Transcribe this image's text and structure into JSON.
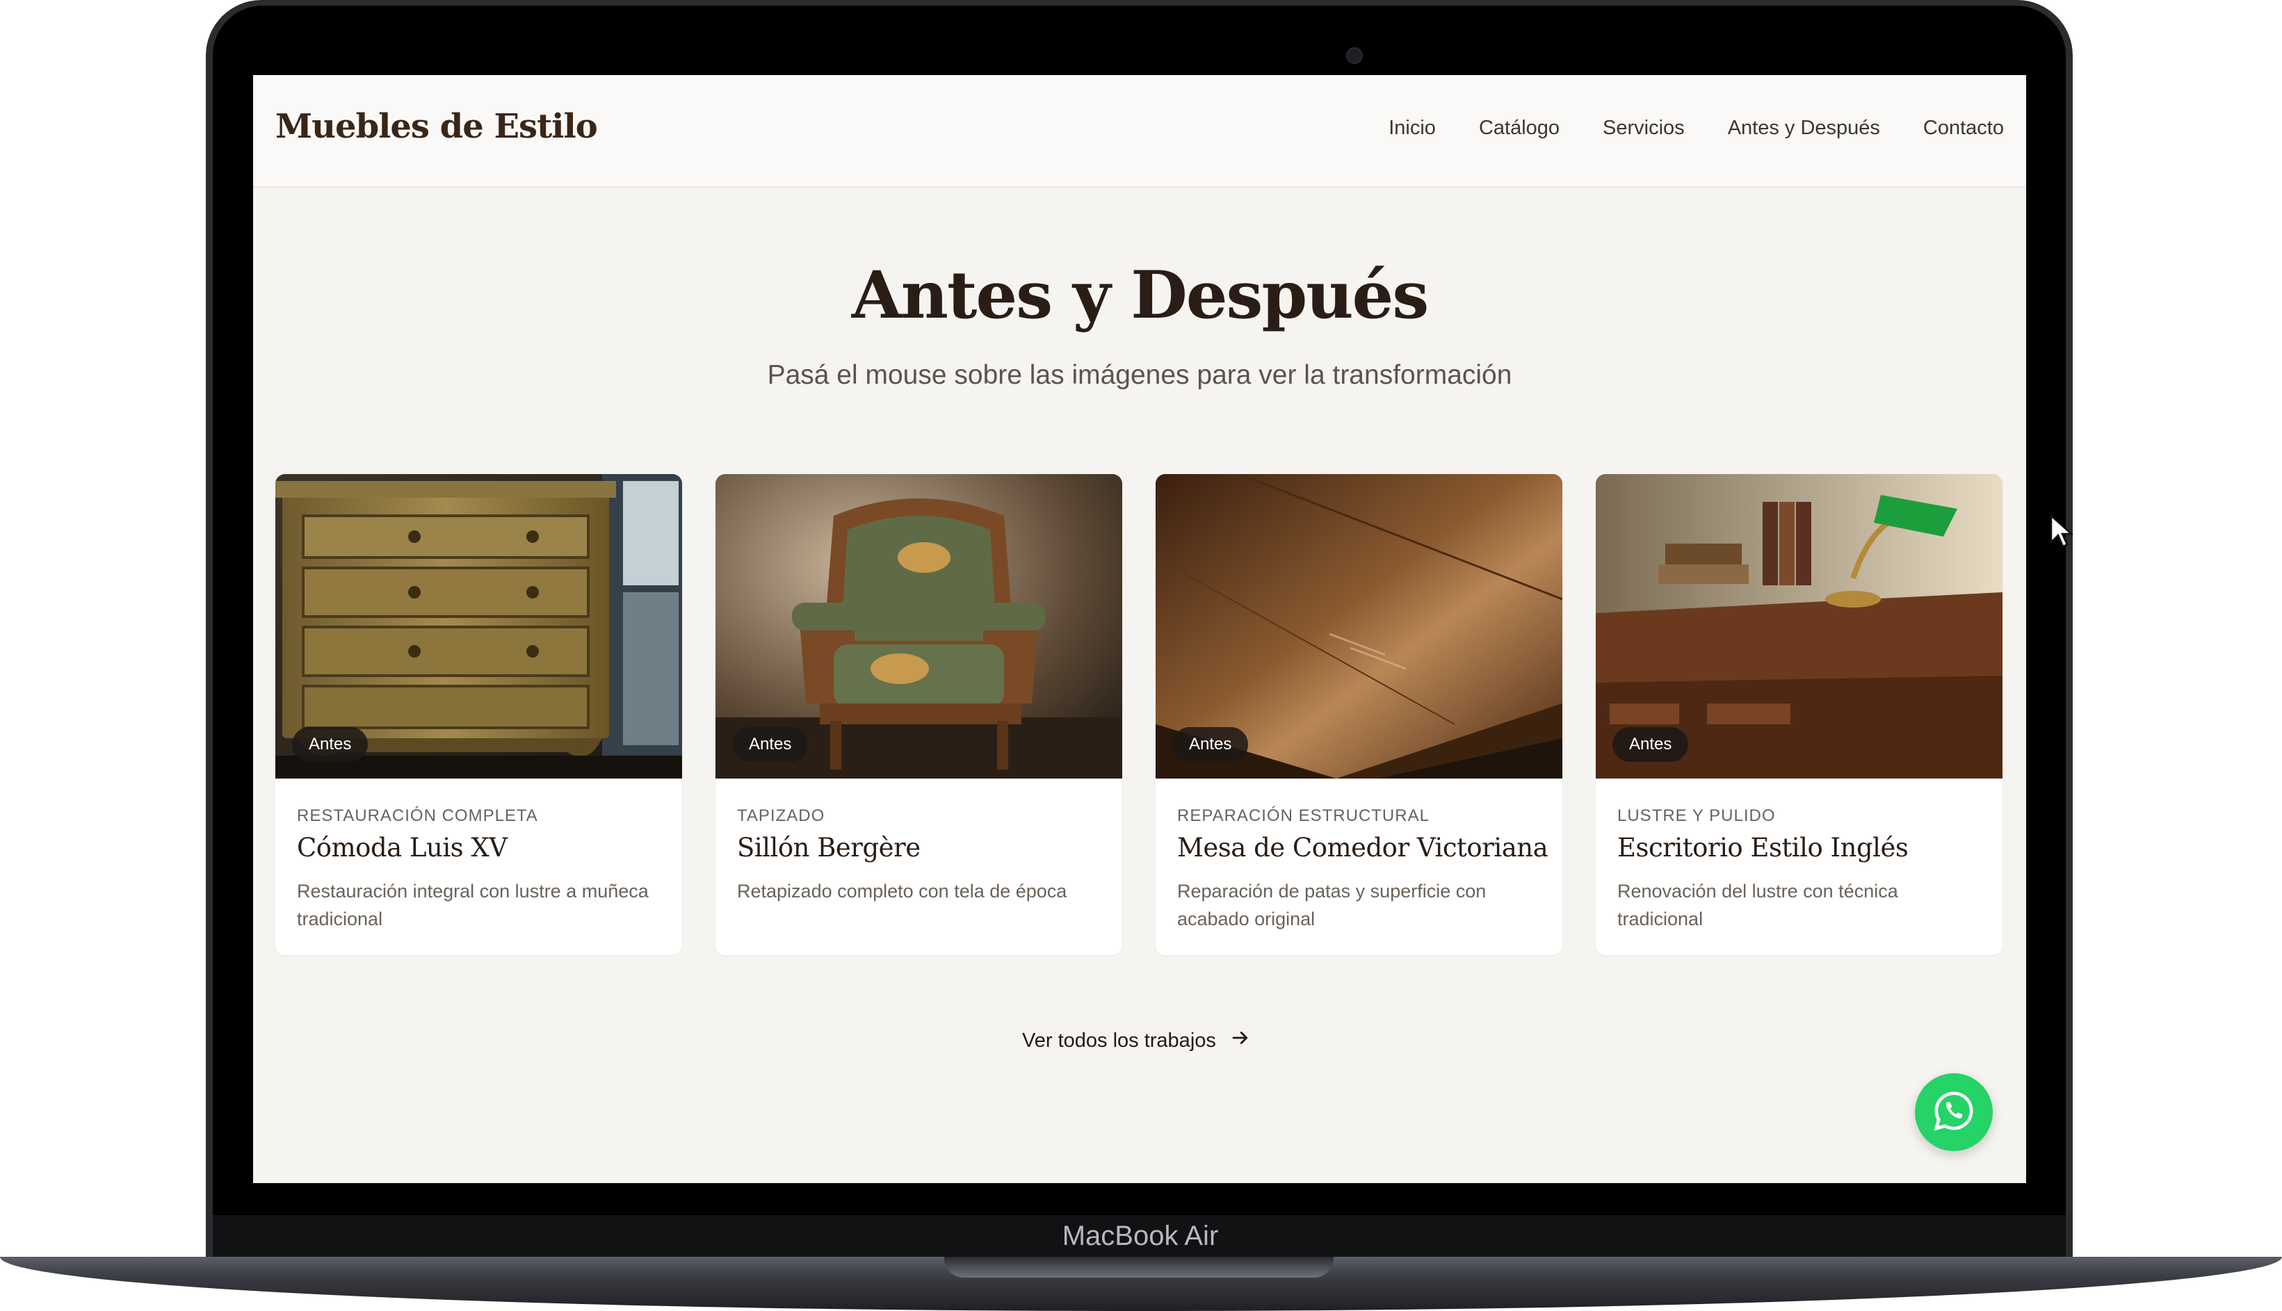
{
  "device": {
    "brand_label": "MacBook Air"
  },
  "header": {
    "logo": "Muebles de Estilo",
    "nav": [
      "Inicio",
      "Catálogo",
      "Servicios",
      "Antes y Después",
      "Contacto"
    ]
  },
  "hero": {
    "title": "Antes y Después",
    "subtitle": "Pasá el mouse sobre las imágenes para ver la transformación"
  },
  "cards": [
    {
      "badge": "Antes",
      "category": "RESTAURACIÓN COMPLETA",
      "title": "Cómoda Luis XV",
      "description": "Restauración integral con lustre a muñeca tradicional"
    },
    {
      "badge": "Antes",
      "category": "TAPIZADO",
      "title": "Sillón Bergère",
      "description": "Retapizado completo con tela de época"
    },
    {
      "badge": "Antes",
      "category": "REPARACIÓN ESTRUCTURAL",
      "title": "Mesa de Comedor Victoriana",
      "description": "Reparación de patas y superficie con acabado original"
    },
    {
      "badge": "Antes",
      "category": "LUSTRE Y PULIDO",
      "title": "Escritorio Estilo Inglés",
      "description": "Renovación del lustre con técnica tradicional"
    }
  ],
  "cta": {
    "view_all": "Ver todos los trabajos",
    "arrow_icon": "arrow-right-icon"
  },
  "floating": {
    "icon": "whatsapp-icon",
    "color": "#25d366"
  },
  "colors": {
    "brand_dark": "#2a1d15",
    "page_bg": "#f6f4f0"
  }
}
